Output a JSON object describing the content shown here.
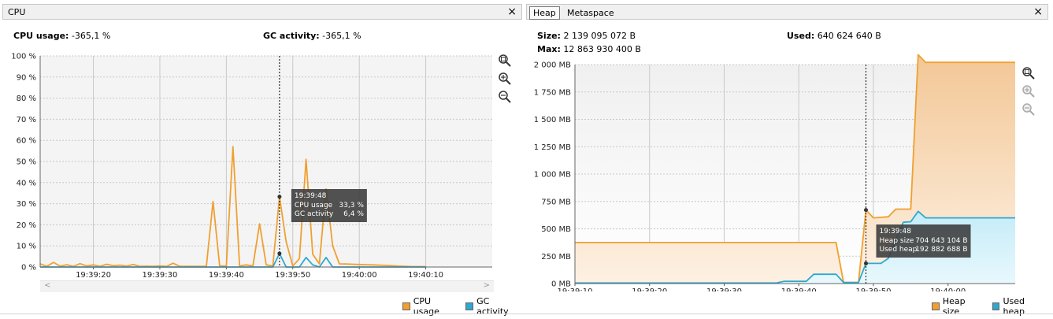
{
  "cpu_panel": {
    "tab_title": "CPU",
    "close_label": "×",
    "stats": [
      {
        "label": "CPU usage:",
        "value": "-365,1 %"
      },
      {
        "label": "GC activity:",
        "value": "-365,1 %"
      }
    ],
    "tooltip": {
      "time": "19:39:48",
      "rows": [
        {
          "label": "CPU usage",
          "value": "33,3 %"
        },
        {
          "label": "GC activity",
          "value": "6,4 %"
        }
      ]
    },
    "legend": [
      {
        "name": "CPU usage",
        "color": "#f0a030"
      },
      {
        "name": "GC activity",
        "color": "#30a8d0"
      }
    ],
    "zoom_icons": [
      "zoom-to-fit-icon",
      "zoom-in-icon",
      "zoom-out-icon"
    ],
    "scroll_left": "<",
    "scroll_right": ">"
  },
  "heap_panel": {
    "tabs": [
      "Heap",
      "Metaspace"
    ],
    "active_tab": "Heap",
    "close_label": "×",
    "stats": [
      {
        "label": "Size:",
        "value": "2 139 095 072 B"
      },
      {
        "label": "Used:",
        "value": "640 624 640 B"
      },
      {
        "label": "Max:",
        "value": "12 863 930 400 B"
      }
    ],
    "tooltip": {
      "time": "19:39:48",
      "rows": [
        {
          "label": "Heap size",
          "value": "704 643 104 B"
        },
        {
          "label": "Used heap",
          "value": "192 882 688 B"
        }
      ]
    },
    "legend": [
      {
        "name": "Heap size",
        "color": "#f0a030"
      },
      {
        "name": "Used heap",
        "color": "#30a8d0"
      }
    ],
    "zoom_icons": [
      "zoom-to-fit-icon",
      "zoom-in-icon",
      "zoom-out-icon"
    ]
  },
  "chart_data": [
    {
      "type": "line",
      "x_unit": "seconds after 19:39:12",
      "xlim": [
        0,
        68
      ],
      "ylim": [
        0,
        100
      ],
      "yticks": [
        "0 %",
        "10 %",
        "20 %",
        "30 %",
        "40 %",
        "50 %",
        "60 %",
        "70 %",
        "80 %",
        "90 %",
        "100 %"
      ],
      "xticks": [
        {
          "t": 8,
          "label": "19:39:20"
        },
        {
          "t": 18,
          "label": "19:39:30"
        },
        {
          "t": 28,
          "label": "19:39:40"
        },
        {
          "t": 38,
          "label": "19:39:50"
        },
        {
          "t": 48,
          "label": "19:40:00"
        },
        {
          "t": 58,
          "label": "19:40:10"
        }
      ],
      "cursor_t": 36,
      "series": [
        {
          "name": "CPU usage",
          "color": "#f0a030",
          "points": [
            [
              0,
              1.5
            ],
            [
              1,
              0.3
            ],
            [
              2,
              2.2
            ],
            [
              3,
              0.4
            ],
            [
              4,
              1.1
            ],
            [
              5,
              0.3
            ],
            [
              6,
              1.6
            ],
            [
              7,
              0.5
            ],
            [
              8,
              1.0
            ],
            [
              9,
              0.3
            ],
            [
              10,
              1.3
            ],
            [
              11,
              0.6
            ],
            [
              12,
              0.9
            ],
            [
              13,
              0.4
            ],
            [
              14,
              1.2
            ],
            [
              15,
              0.3
            ],
            [
              16,
              0.4
            ],
            [
              17,
              0.3
            ],
            [
              18,
              0.5
            ],
            [
              19,
              0.3
            ],
            [
              20,
              1.8
            ],
            [
              21,
              0.3
            ],
            [
              22,
              0.3
            ],
            [
              23,
              0.3
            ],
            [
              24,
              0.3
            ],
            [
              25,
              0.3
            ],
            [
              26,
              31
            ],
            [
              27,
              0.5
            ],
            [
              28,
              0.5
            ],
            [
              29,
              57
            ],
            [
              30,
              0.5
            ],
            [
              31,
              1.0
            ],
            [
              32,
              0.5
            ],
            [
              33,
              20.5
            ],
            [
              34,
              1.0
            ],
            [
              35,
              0.5
            ],
            [
              36,
              33.3
            ],
            [
              37,
              12
            ],
            [
              38,
              0.5
            ],
            [
              39,
              4
            ],
            [
              40,
              51
            ],
            [
              41,
              6
            ],
            [
              42,
              1.5
            ],
            [
              43,
              37
            ],
            [
              44,
              10
            ],
            [
              45,
              1.5
            ],
            [
              46,
              1.4
            ],
            [
              47,
              1.3
            ],
            [
              48,
              1.2
            ],
            [
              49,
              1.1
            ],
            [
              50,
              1.0
            ],
            [
              51,
              0.9
            ],
            [
              52,
              0.8
            ],
            [
              53,
              0.6
            ],
            [
              54,
              0.4
            ],
            [
              55,
              0.3
            ],
            [
              56,
              0.2
            ],
            [
              57,
              0.2
            ],
            [
              58,
              0.2
            ]
          ]
        },
        {
          "name": "GC activity",
          "color": "#30a8d0",
          "points": [
            [
              0,
              0
            ],
            [
              35,
              0
            ],
            [
              36,
              6.4
            ],
            [
              37,
              0
            ],
            [
              39,
              0
            ],
            [
              40,
              4.5
            ],
            [
              41,
              1
            ],
            [
              42,
              0
            ],
            [
              43,
              4.5
            ],
            [
              44,
              0
            ],
            [
              58,
              0
            ]
          ]
        }
      ]
    },
    {
      "type": "area",
      "x_unit": "seconds after 19:39:10",
      "xlim": [
        0,
        59
      ],
      "ylim": [
        0,
        2000
      ],
      "yticks": [
        "0 MB",
        "250 MB",
        "500 MB",
        "750 MB",
        "1 000 MB",
        "1 250 MB",
        "1 500 MB",
        "1 750 MB",
        "2 000 MB"
      ],
      "xticks": [
        {
          "t": 0,
          "label": "19:39:10"
        },
        {
          "t": 10,
          "label": "19:39:20"
        },
        {
          "t": 20,
          "label": "19:39:30"
        },
        {
          "t": 30,
          "label": "19:39:40"
        },
        {
          "t": 40,
          "label": "19:39:50"
        },
        {
          "t": 50,
          "label": "19:40:00"
        }
      ],
      "cursor_t": 39,
      "series": [
        {
          "name": "Heap size",
          "color": "#f0a030",
          "points": [
            [
              0,
              375
            ],
            [
              35,
              375
            ],
            [
              36,
              10
            ],
            [
              38,
              10
            ],
            [
              39,
              672
            ],
            [
              40,
              600
            ],
            [
              42,
              610
            ],
            [
              43,
              680
            ],
            [
              45,
              680
            ],
            [
              46,
              2090
            ],
            [
              47,
              2020
            ],
            [
              59,
              2020
            ]
          ]
        },
        {
          "name": "Used heap",
          "color": "#30a8d0",
          "points": [
            [
              0,
              5
            ],
            [
              27,
              5
            ],
            [
              28,
              20
            ],
            [
              31,
              20
            ],
            [
              32,
              85
            ],
            [
              35,
              85
            ],
            [
              36,
              10
            ],
            [
              38,
              10
            ],
            [
              39,
              184
            ],
            [
              41,
              184
            ],
            [
              42,
              230
            ],
            [
              44,
              560
            ],
            [
              45,
              565
            ],
            [
              46,
              660
            ],
            [
              47,
              600
            ],
            [
              59,
              600
            ]
          ]
        }
      ]
    }
  ]
}
